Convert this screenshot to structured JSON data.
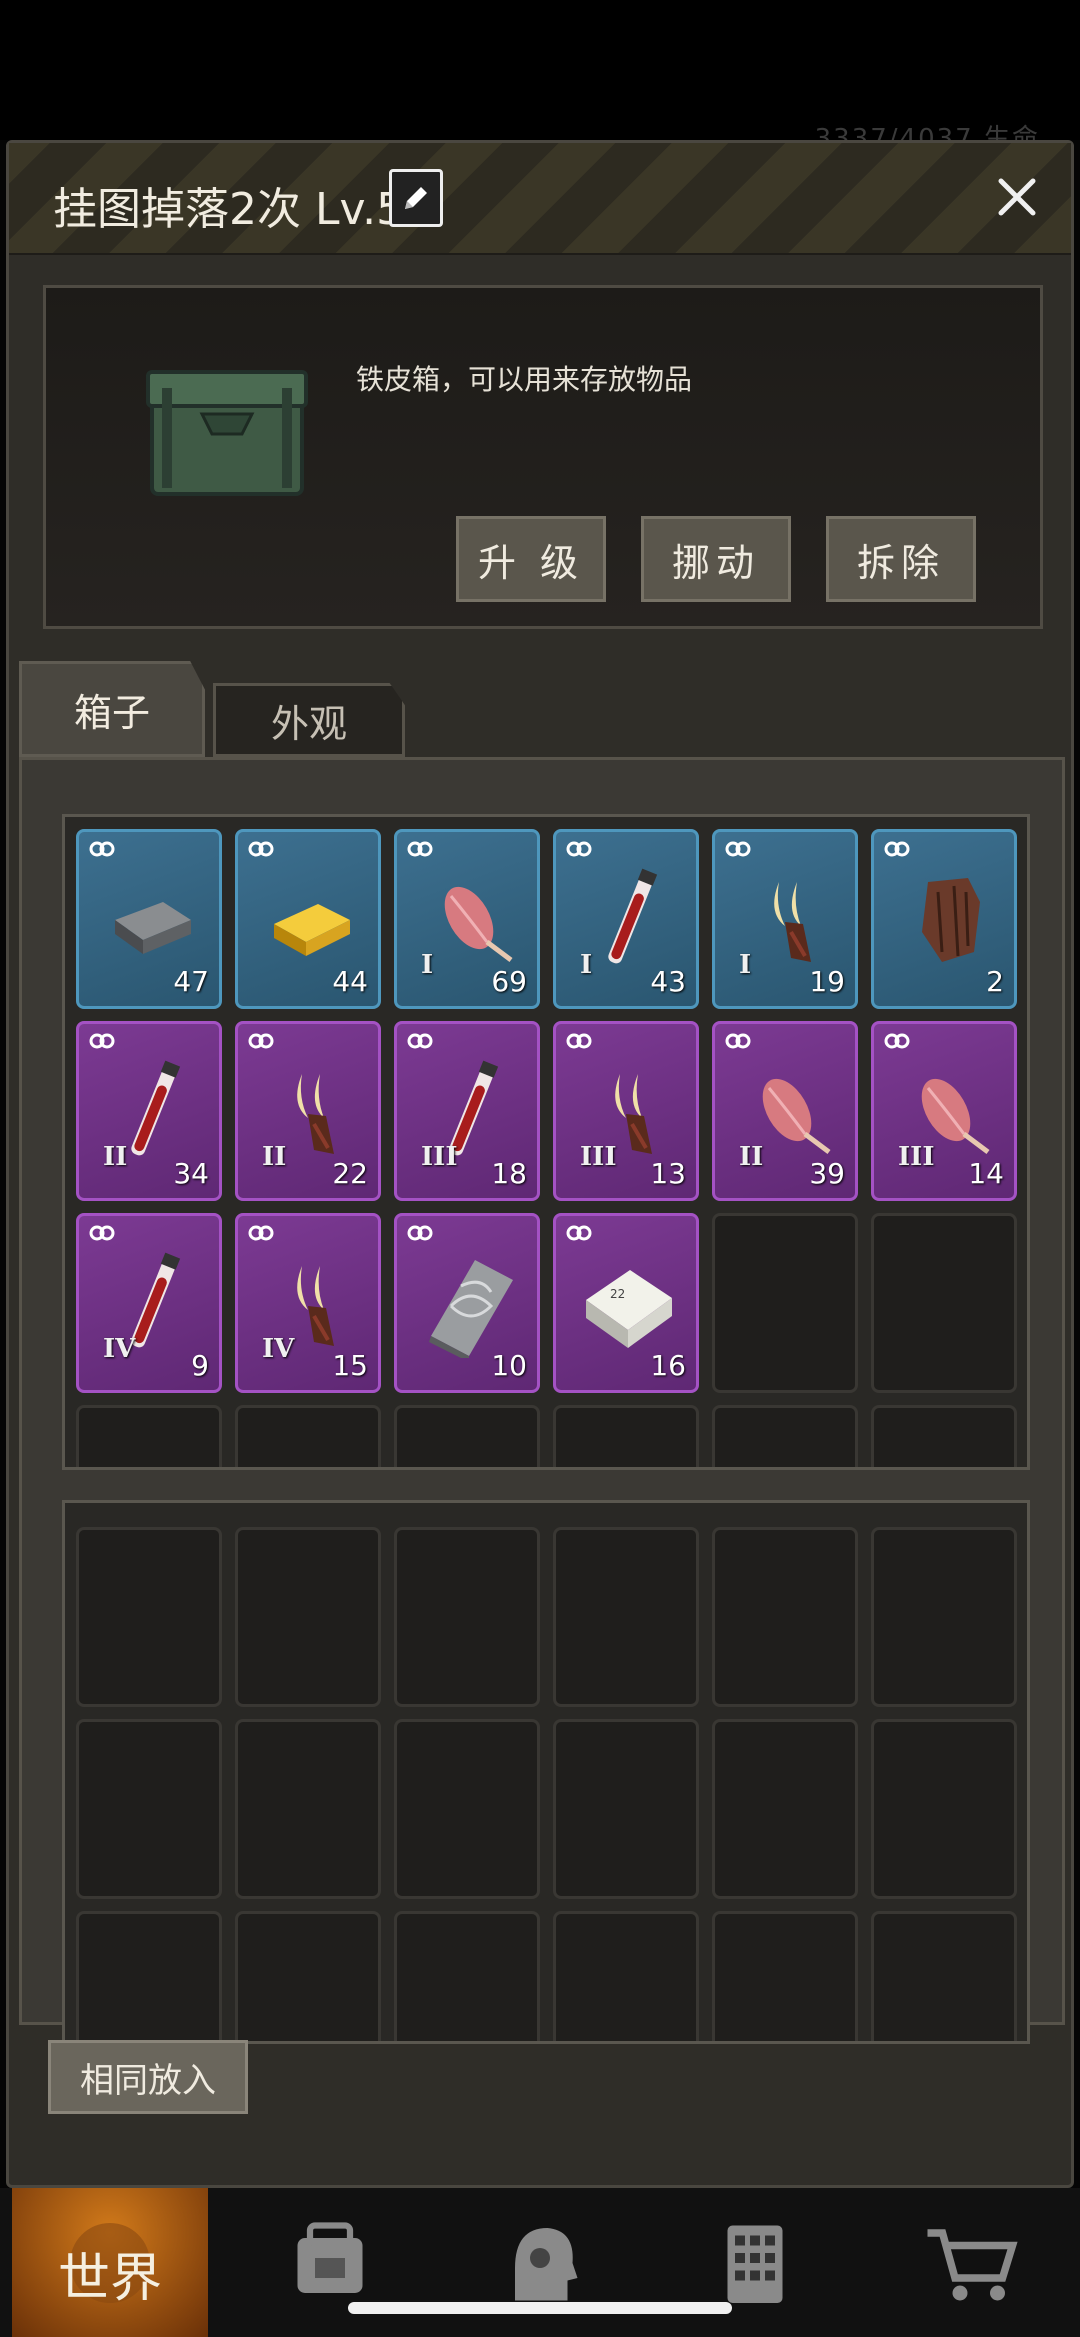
{
  "status_bar": {
    "ghost_text": "3337/4037  生命"
  },
  "header": {
    "title": "挂图掉落2次 Lv.5"
  },
  "box_info": {
    "description": "铁皮箱，可以用来存放物品",
    "buttons": {
      "upgrade": "升 级",
      "move": "挪动",
      "remove": "拆除"
    }
  },
  "tabs": {
    "box": "箱子",
    "appearance": "外观"
  },
  "box_items": [
    {
      "rarity": "blue",
      "icon": "iron-ingot-icon",
      "tier": "",
      "qty": "47"
    },
    {
      "rarity": "blue",
      "icon": "gold-ingot-icon",
      "tier": "",
      "qty": "44"
    },
    {
      "rarity": "blue",
      "icon": "muscle-tissue-icon",
      "tier": "I",
      "qty": "69"
    },
    {
      "rarity": "blue",
      "icon": "blood-vial-icon",
      "tier": "I",
      "qty": "43"
    },
    {
      "rarity": "blue",
      "icon": "claw-icon",
      "tier": "I",
      "qty": "19"
    },
    {
      "rarity": "blue",
      "icon": "bark-piece-icon",
      "tier": "",
      "qty": "2"
    },
    {
      "rarity": "purple",
      "icon": "blood-vial-icon",
      "tier": "II",
      "qty": "34"
    },
    {
      "rarity": "purple",
      "icon": "claw-icon",
      "tier": "II",
      "qty": "22"
    },
    {
      "rarity": "purple",
      "icon": "blood-vial-icon",
      "tier": "III",
      "qty": "18"
    },
    {
      "rarity": "purple",
      "icon": "claw-icon",
      "tier": "III",
      "qty": "13"
    },
    {
      "rarity": "purple",
      "icon": "muscle-tissue-icon",
      "tier": "II",
      "qty": "39"
    },
    {
      "rarity": "purple",
      "icon": "muscle-tissue-icon",
      "tier": "III",
      "qty": "14"
    },
    {
      "rarity": "purple",
      "icon": "blood-vial-icon",
      "tier": "IV",
      "qty": "9"
    },
    {
      "rarity": "purple",
      "icon": "claw-icon",
      "tier": "IV",
      "qty": "15"
    },
    {
      "rarity": "purple",
      "icon": "damascus-plate-icon",
      "tier": "",
      "qty": "10"
    },
    {
      "rarity": "purple",
      "icon": "alloy-block-icon",
      "tier": "",
      "qty": "16"
    },
    {
      "rarity": "empty"
    },
    {
      "rarity": "empty"
    },
    {
      "rarity": "empty"
    },
    {
      "rarity": "empty"
    },
    {
      "rarity": "empty"
    },
    {
      "rarity": "empty"
    },
    {
      "rarity": "empty"
    },
    {
      "rarity": "empty"
    }
  ],
  "inventory_slots_count": 18,
  "fill_button": "相同放入",
  "bottom_nav": [
    {
      "label": "世界",
      "icon": "globe-icon",
      "active": true
    },
    {
      "label": "",
      "icon": "backpack-icon",
      "active": false
    },
    {
      "label": "",
      "icon": "head-profile-icon",
      "active": false
    },
    {
      "label": "",
      "icon": "building-icon",
      "active": false
    },
    {
      "label": "",
      "icon": "cart-icon",
      "active": false
    }
  ],
  "colors": {
    "blue_rarity": "#3d7090",
    "purple_rarity": "#7c3a93",
    "world_tab": "#d27a1a"
  }
}
